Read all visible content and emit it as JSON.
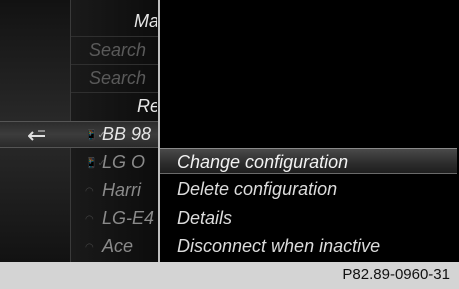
{
  "device_list": {
    "header_1": "Man",
    "search_1": "Search",
    "search_2": "Search",
    "header_2": "Rec",
    "devices": [
      {
        "name": "BB 98",
        "icon": "phone-bluetooth-icon"
      },
      {
        "name": "LG O",
        "icon": "phone-bluetooth-icon"
      },
      {
        "name": "Harri",
        "icon": "wifi-icon"
      },
      {
        "name": "LG-E4",
        "icon": "wifi-icon"
      },
      {
        "name": "Ace",
        "icon": "wifi-icon"
      }
    ],
    "back_icon": "back-arrow-icon"
  },
  "menu": {
    "items": [
      {
        "label": "Change configuration"
      },
      {
        "label": "Delete configuration"
      },
      {
        "label": "Details"
      },
      {
        "label": "Disconnect when inactive"
      }
    ],
    "selected_index": 0
  },
  "caption": "P82.89-0960-31",
  "colors": {
    "background": "#000000",
    "text": "#dcdcdc",
    "highlight": "#3a3a3a",
    "caption_bg": "#d4d4d4"
  }
}
